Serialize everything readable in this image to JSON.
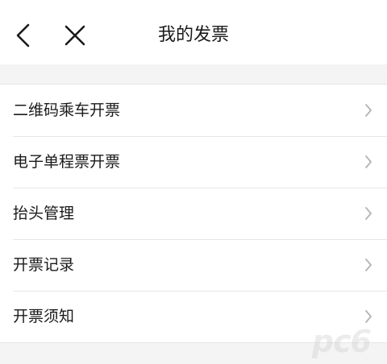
{
  "header": {
    "title": "我的发票",
    "back_icon": "chevron-left-icon",
    "close_icon": "close-icon"
  },
  "menu": {
    "items": [
      {
        "label": "二维码乘车开票"
      },
      {
        "label": "电子单程票开票"
      },
      {
        "label": "抬头管理"
      },
      {
        "label": "开票记录"
      },
      {
        "label": "开票须知"
      }
    ],
    "chevron_icon": "chevron-right-icon"
  },
  "colors": {
    "background": "#f4f4f4",
    "surface": "#ffffff",
    "divider": "#e6e6e6",
    "text": "#1a1a1a",
    "chevron": "#b3b3b3"
  },
  "watermark": {
    "text": "pc6"
  }
}
